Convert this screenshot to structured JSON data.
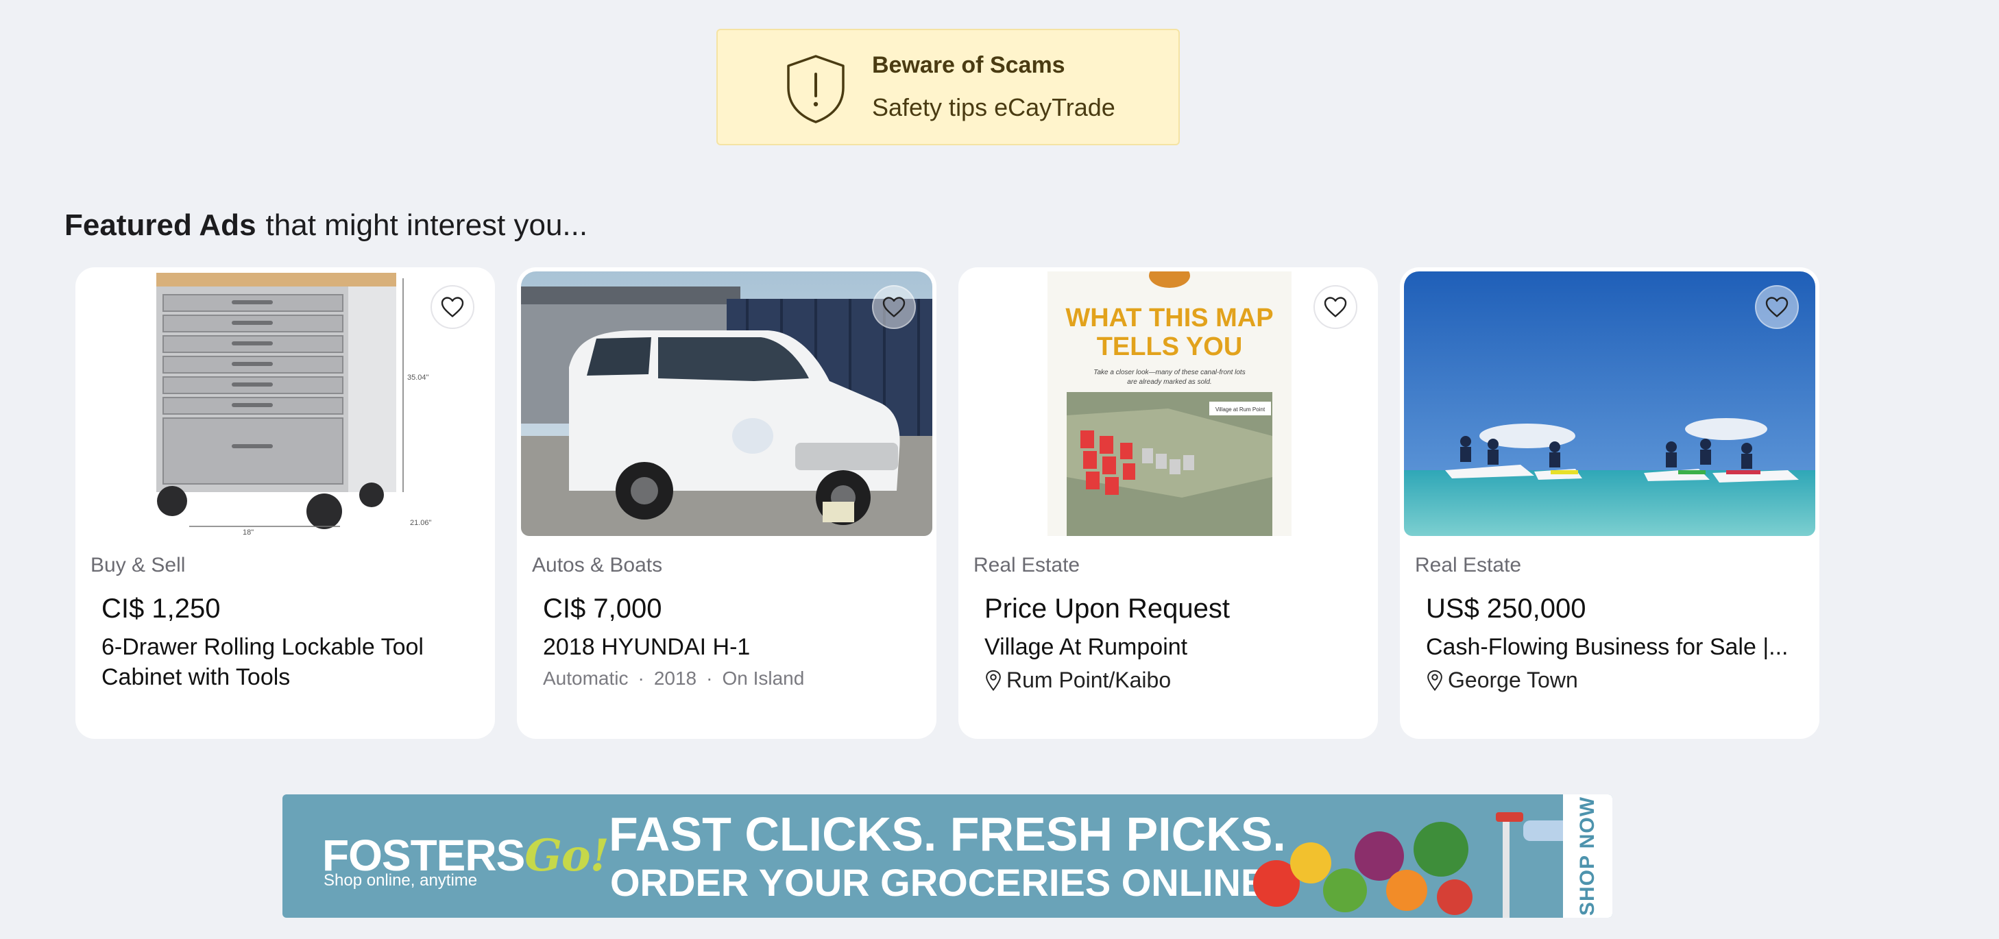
{
  "scam_notice": {
    "title": "Beware of Scams",
    "subtitle": "Safety tips eCayTrade",
    "icon": "shield-alert-icon"
  },
  "featured": {
    "heading_bold": "Featured Ads",
    "heading_rest": "that might interest you..."
  },
  "cards": [
    {
      "category": "Buy & Sell",
      "price": "CI$ 1,250",
      "title": "6-Drawer Rolling Lockable Tool Cabinet with Tools",
      "image": "tool-cabinet-photo",
      "image_labels": {
        "height": "35.04\"",
        "depth": "21.06\"",
        "width": "18\""
      }
    },
    {
      "category": "Autos & Boats",
      "price": "CI$ 7,000",
      "title": "2018 HYUNDAI H-1",
      "meta": [
        "Automatic",
        "2018",
        "On Island"
      ],
      "image": "white-van-photo"
    },
    {
      "category": "Real Estate",
      "price": "Price Upon Request",
      "title": "Village At Rumpoint",
      "location": "Rum Point/Kaibo",
      "image": "map-flyer-photo",
      "image_text": {
        "headline_1": "WHAT THIS MAP",
        "headline_2": "TELLS YOU",
        "caption_1": "Take a closer look—many of these canal-front lots",
        "caption_2": "are already marked as sold.",
        "map_label": "Village at Rum Point"
      }
    },
    {
      "category": "Real Estate",
      "price": "US$ 250,000",
      "title": "Cash-Flowing Business for Sale |...",
      "location": "George Town",
      "image": "jet-ski-photo"
    }
  ],
  "banner": {
    "logo": "FOSTERS",
    "logo_accent": "Go!",
    "tagline": "Shop online, anytime",
    "line1": "FAST CLICKS. FRESH PICKS.",
    "line2": "ORDER YOUR GROCERIES ONLINE",
    "cta": "SHOP NOW"
  },
  "colors": {
    "page_bg": "#eff1f5",
    "scam_bg": "#fff4cc",
    "scam_text": "#4a3b12",
    "banner_bg": "#6aa3b8",
    "banner_accent": "#c6d84a"
  }
}
